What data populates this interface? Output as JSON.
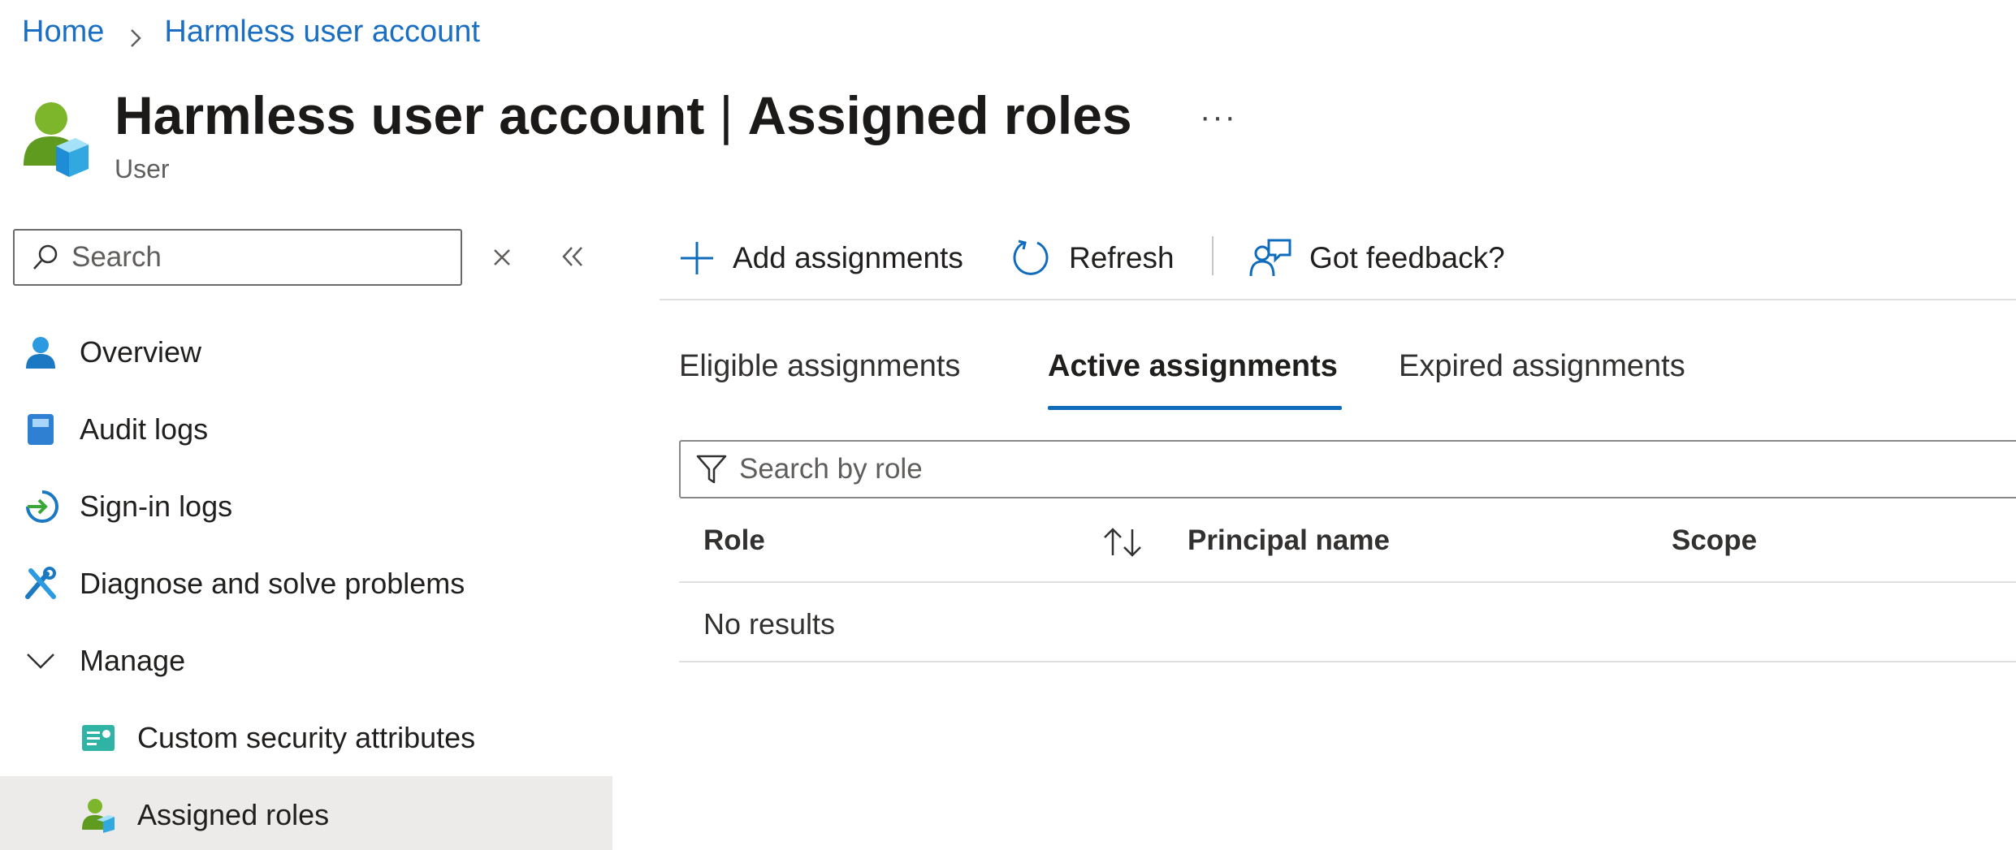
{
  "breadcrumb": {
    "home": "Home",
    "current": "Harmless user account"
  },
  "header": {
    "title_name": "Harmless user account",
    "title_separator": "|",
    "title_page": "Assigned roles",
    "more": "···",
    "subtitle": "User"
  },
  "sidebar": {
    "search_placeholder": "Search",
    "items": [
      {
        "label": "Overview",
        "icon": "user-icon"
      },
      {
        "label": "Audit logs",
        "icon": "book-icon"
      },
      {
        "label": "Sign-in logs",
        "icon": "sign-in-icon"
      },
      {
        "label": "Diagnose and solve problems",
        "icon": "wrench-icon"
      },
      {
        "label": "Manage",
        "icon": "chevron-down-icon"
      },
      {
        "label": "Custom security attributes",
        "icon": "attributes-icon"
      },
      {
        "label": "Assigned roles",
        "icon": "assigned-roles-icon",
        "selected": true
      }
    ]
  },
  "toolbar": {
    "add_label": "Add assignments",
    "refresh_label": "Refresh",
    "feedback_label": "Got feedback?"
  },
  "tabs": [
    {
      "label": "Eligible assignments",
      "active": false
    },
    {
      "label": "Active assignments",
      "active": true
    },
    {
      "label": "Expired assignments",
      "active": false
    }
  ],
  "filter": {
    "placeholder": "Search by role"
  },
  "table": {
    "columns": [
      "Role",
      "Principal name",
      "Scope"
    ],
    "empty_text": "No results"
  },
  "colors": {
    "link": "#1a6fc2",
    "accent": "#0f6cbd",
    "selected_bg": "#edebe9"
  }
}
